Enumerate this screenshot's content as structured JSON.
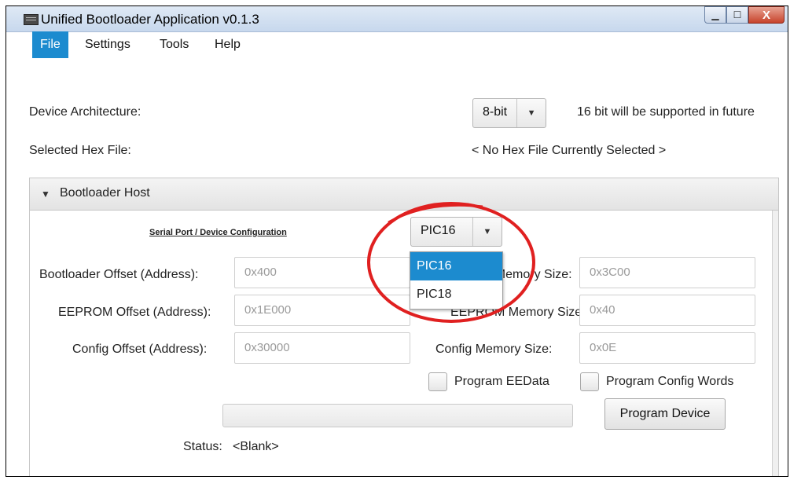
{
  "window": {
    "title": "Unified Bootloader Application v0.1.3",
    "min_glyph": "▁",
    "max_glyph": "☐",
    "close_glyph": "X"
  },
  "menu": {
    "items": [
      "File",
      "Settings",
      "Tools",
      "Help"
    ]
  },
  "device_architecture": {
    "label": "Device Architecture:",
    "selected": "8-bit",
    "note": "16 bit will be supported in future"
  },
  "hex_file": {
    "label": "Selected Hex File:",
    "value": "< No Hex File Currently Selected >"
  },
  "bootloader_host": {
    "title": "Bootloader Host",
    "config_link": "Serial Port / Device Configuration",
    "device_family": {
      "selected": "PIC16",
      "options": [
        "PIC16",
        "PIC18"
      ]
    },
    "bootloader_offset": {
      "label": "Bootloader Offset (Address):",
      "placeholder": "0x400"
    },
    "program_memory_size": {
      "label": "Program Memory Size:",
      "placeholder": "0x3C00"
    },
    "eeprom_offset": {
      "label": "EEPROM Offset (Address):",
      "placeholder": "0x1E000"
    },
    "eeprom_memory_size": {
      "label": "EEPROM Memory Size:",
      "placeholder": "0x40"
    },
    "config_offset": {
      "label": "Config Offset (Address):",
      "placeholder": "0x30000"
    },
    "config_memory_size": {
      "label": "Config Memory Size:",
      "placeholder": "0x0E"
    },
    "program_eedata": {
      "label": "Program EEData",
      "checked": false
    },
    "program_config_words": {
      "label": "Program Config Words",
      "checked": false
    },
    "program_button": "Program Device",
    "progress": 0,
    "status_label": "Status:",
    "status_value": "<Blank>"
  },
  "colors": {
    "accent": "#1c8bcf",
    "annotation": "#e02020"
  }
}
